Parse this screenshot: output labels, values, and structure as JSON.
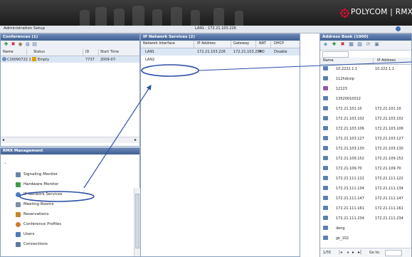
{
  "header": {
    "logo_text": "POLYCOM | RMX 1000",
    "colors": {
      "bar": "#2a2a2a",
      "logo_red": "#c8102e"
    }
  },
  "menubar": {
    "items": [
      "Administration",
      "Setup"
    ],
    "lan_address": "LAN1 : 172.21.103.226"
  },
  "conferences": {
    "title": "Conferences (1)",
    "columns": [
      "Name",
      "Status",
      "ID",
      "Start Time"
    ],
    "rows": [
      {
        "name": "C20090722 1",
        "status": "Empty",
        "id": "7737",
        "start": "2009-07-"
      }
    ]
  },
  "ip_services": {
    "title": "IP Network Services (2)",
    "columns": [
      "Network Interface",
      "IP Address",
      "Gateway",
      "NAT",
      "DHCP"
    ],
    "rows": [
      {
        "iface": "LAN1",
        "ip": "172.21.103.226",
        "gateway": "172.21.103.254",
        "nat": "NO",
        "dhcp": "Disable"
      },
      {
        "iface": "LAN2",
        "ip": "",
        "gateway": "",
        "nat": "",
        "dhcp": ""
      }
    ]
  },
  "management": {
    "title": "RMX Management",
    "items": [
      {
        "label": "Signaling Monitor",
        "icon": "signaling-monitor-icon"
      },
      {
        "label": "Hardware Monitor",
        "icon": "hardware-monitor-icon"
      },
      {
        "label": "IP Network Services",
        "icon": "ip-network-services-icon",
        "selected": true
      },
      {
        "label": "Meeting Rooms",
        "icon": "meeting-rooms-icon"
      },
      {
        "label": "Reservations",
        "icon": "reservations-icon"
      },
      {
        "label": "Conference Profiles",
        "icon": "conference-profiles-icon"
      },
      {
        "label": "Users",
        "icon": "users-icon"
      },
      {
        "label": "Connections",
        "icon": "connections-icon"
      }
    ]
  },
  "address_book": {
    "title": "Address Book (1000)",
    "columns": [
      "Name",
      "IP Address"
    ],
    "rows": [
      {
        "name": "10.2222.1.1",
        "ip": "10.222.1.1"
      },
      {
        "name": "112hdcsip",
        "ip": ""
      },
      {
        "name": "12123",
        "ip": ""
      },
      {
        "name": "13520010012",
        "ip": ""
      },
      {
        "name": "172.21.101.10",
        "ip": "172.21.101.10"
      },
      {
        "name": "172.21.103.102",
        "ip": "172.21.103.102"
      },
      {
        "name": "172.21.103.106",
        "ip": "172.21.103.106"
      },
      {
        "name": "172.21.103.127",
        "ip": "172.21.103.127"
      },
      {
        "name": "172.21.103.130",
        "ip": "172.21.103.130"
      },
      {
        "name": "172.21.109.152",
        "ip": "172.21.109.152"
      },
      {
        "name": "172.21.109.70",
        "ip": "172.21.109.70"
      },
      {
        "name": "172.21.111.122",
        "ip": "172.21.111.122"
      },
      {
        "name": "172.21.111.134",
        "ip": "172.21.111.134"
      },
      {
        "name": "172.21.111.147",
        "ip": "172.21.111.147"
      },
      {
        "name": "172.21.111.161",
        "ip": "172.21.111.161"
      },
      {
        "name": "172.21.111.234",
        "ip": "172.21.111.234"
      },
      {
        "name": "deng",
        "ip": ""
      },
      {
        "name": "gk_102",
        "ip": ""
      }
    ],
    "pager": {
      "page": "1/55",
      "goto_label": "Go to:"
    }
  },
  "annotation_color": "#2d4fa8"
}
